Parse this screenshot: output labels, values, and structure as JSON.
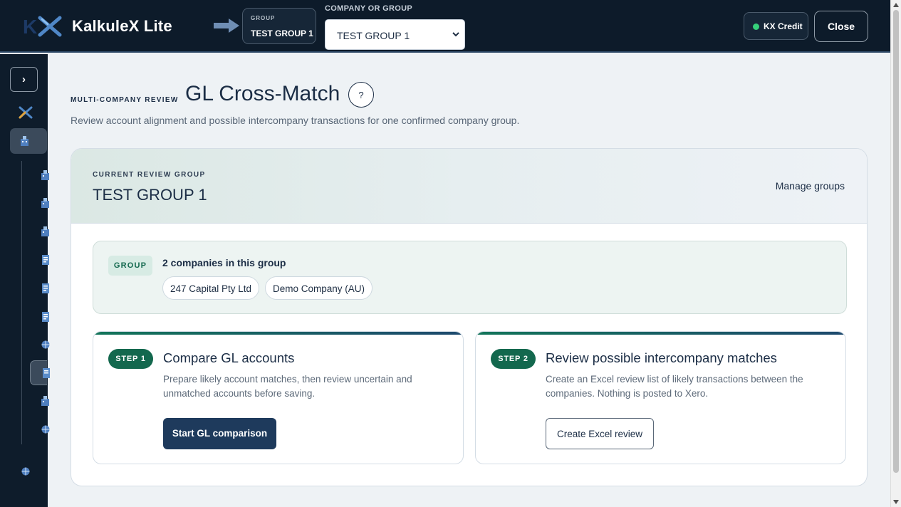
{
  "header": {
    "brand": "KalkuleX Lite",
    "group_chip_label": "GROUP",
    "group_chip_value": "TEST GROUP 1",
    "company_or_group_label": "COMPANY OR GROUP",
    "selected_value": "TEST GROUP 1",
    "credit_label": "KX Credit",
    "close_label": "Close"
  },
  "sidebar": {
    "toggle_label": "›"
  },
  "page": {
    "eyebrow": "MULTI-COMPANY REVIEW",
    "title": "GL Cross-Match",
    "help_label": "?",
    "subtitle": "Review account alignment and possible intercompany transactions for one confirmed company group."
  },
  "review": {
    "label": "CURRENT REVIEW GROUP",
    "group_name": "TEST GROUP 1",
    "manage_link": "Manage groups"
  },
  "group_info": {
    "tag": "GROUP",
    "count_text": "2 companies in this group",
    "companies": [
      "247 Capital Pty Ltd",
      "Demo Company (AU)"
    ]
  },
  "steps": [
    {
      "badge": "STEP 1",
      "title": "Compare GL accounts",
      "description": "Prepare likely account matches, then review uncertain and unmatched accounts before saving.",
      "button": "Start GL comparison"
    },
    {
      "badge": "STEP 2",
      "title": "Review possible intercompany matches",
      "description": "Create an Excel review list of likely transactions between the companies. Nothing is posted to Xero.",
      "button": "Create Excel review"
    }
  ],
  "colors": {
    "header_bg": "#0d1b2a",
    "accent_green": "#13684e",
    "primary_button": "#1e3a5c",
    "status_dot": "#35d07a"
  }
}
